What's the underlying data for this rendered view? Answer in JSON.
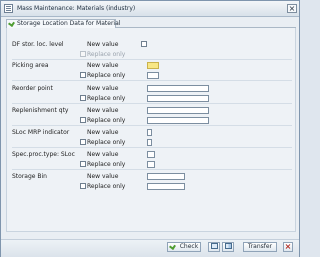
{
  "window": {
    "title": "Mass Maintenance: Materials (industry)",
    "close_icon": "close-icon"
  },
  "tab": {
    "label": "Storage Location Data for Material",
    "icon": "checkmark-icon"
  },
  "fields": [
    {
      "label": "DF stor. loc. level",
      "new_label": "New value",
      "replace_label": "Replace only",
      "field_type": "checkbox",
      "replace_disabled": true,
      "value": ""
    },
    {
      "label": "Picking area",
      "new_label": "New value",
      "replace_label": "Replace only",
      "field_type": "text",
      "replace_disabled": false,
      "value": ""
    },
    {
      "label": "Reorder point",
      "new_label": "New value",
      "replace_label": "Replace only",
      "field_type": "text",
      "replace_disabled": false,
      "value": ""
    },
    {
      "label": "Replenishment qty",
      "new_label": "New value",
      "replace_label": "Replace only",
      "field_type": "text",
      "replace_disabled": false,
      "value": ""
    },
    {
      "label": "SLoc MRP indicator",
      "new_label": "New value",
      "replace_label": "Replace only",
      "field_type": "text",
      "replace_disabled": false,
      "value": ""
    },
    {
      "label": "Spec.proc.type: SLoc",
      "new_label": "New value",
      "replace_label": "Replace only",
      "field_type": "text",
      "replace_disabled": false,
      "value": ""
    },
    {
      "label": "Storage Bin",
      "new_label": "New value",
      "replace_label": "Replace only",
      "field_type": "text",
      "replace_disabled": false,
      "value": ""
    }
  ],
  "footer": {
    "check_label": "Check",
    "transfer_label": "Transfer"
  },
  "colors": {
    "accent": "#4f9d32",
    "required_yellow": "#f8e785",
    "title_bg": "#dfe6ee"
  }
}
